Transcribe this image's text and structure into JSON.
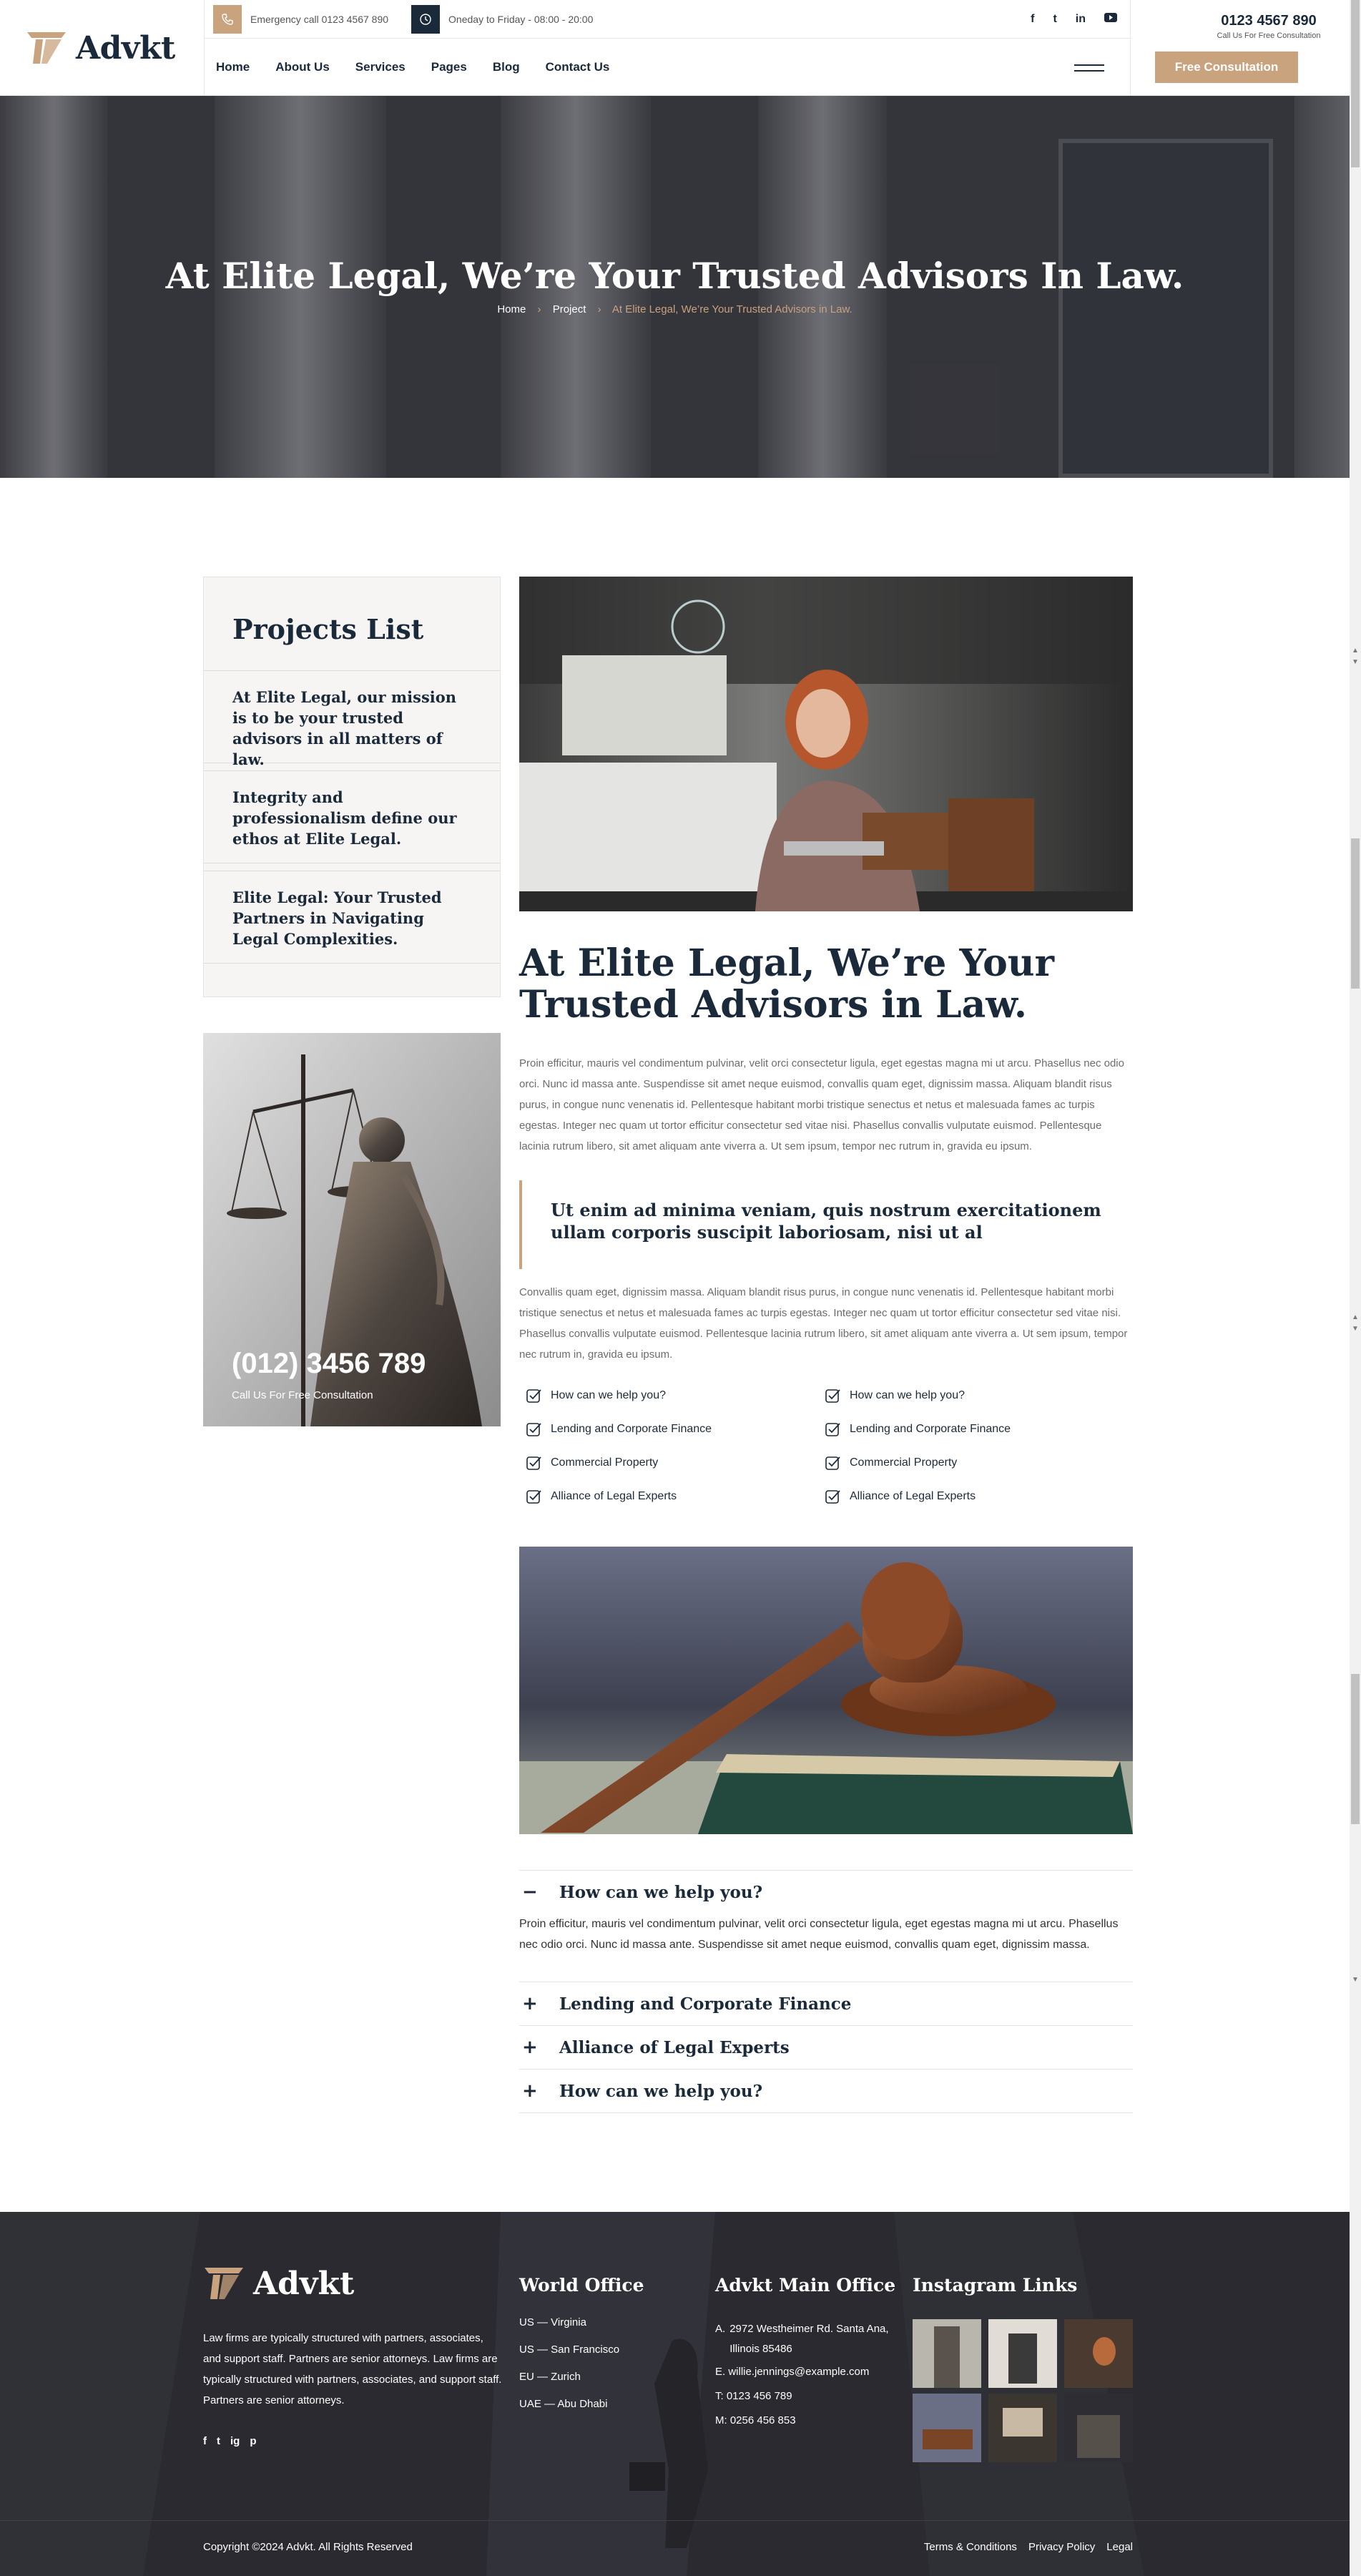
{
  "brand": {
    "name": "Advkt",
    "accent": "#c9a27e",
    "dark": "#1b2a3a"
  },
  "topbar": {
    "emergency": "Emergency call 0123 4567 890",
    "hours": "Oneday to Friday - 08:00 - 20:00",
    "social": [
      "f",
      "t",
      "in",
      "yt"
    ]
  },
  "nav": {
    "items": [
      "Home",
      "About Us",
      "Services",
      "Pages",
      "Blog",
      "Contact Us"
    ],
    "phone": "0123 4567 890",
    "phone_sub": "Call Us For Free Consultation",
    "cta": "Free Consultation"
  },
  "hero": {
    "title": "At Elite Legal, We’re Your Trusted Advisors In Law.",
    "breadcrumb": [
      "Home",
      "Project",
      "At Elite Legal, We’re Your Trusted Advisors in Law."
    ]
  },
  "sidebar": {
    "title": "Projects List",
    "items": [
      "At Elite Legal, our mission is to be your trusted advisors in all matters of law.",
      "Integrity and professionalism define our ethos at Elite Legal.",
      "Elite Legal: Your Trusted Partners in Navigating Legal Complexities."
    ],
    "phone": "(012) 3456 789",
    "phone_sub": "Call Us For Free Consultation"
  },
  "main": {
    "title": "At Elite Legal, We’re Your Trusted Advisors in Law.",
    "para1": "Proin efficitur, mauris vel condimentum pulvinar, velit orci consectetur ligula, eget egestas magna mi ut arcu. Phasellus nec odio orci. Nunc id massa ante. Suspendisse sit amet neque euismod, convallis quam eget, dignissim massa. Aliquam blandit risus purus, in congue nunc venenatis id. Pellentesque habitant morbi tristique senectus et netus et malesuada fames ac turpis egestas. Integer nec quam ut tortor efficitur consectetur sed vitae nisi. Phasellus convallis vulputate euismod. Pellentesque lacinia rutrum libero, sit amet aliquam ante viverra a. Ut sem ipsum, tempor nec rutrum in, gravida eu ipsum.",
    "quote": "Ut enim ad minima veniam, quis nostrum exercitationem ullam corporis suscipit laboriosam, nisi ut al",
    "para2": "Convallis quam eget, dignissim massa. Aliquam blandit risus purus, in congue nunc venenatis id. Pellentesque habitant morbi tristique senectus et netus et malesuada fames ac turpis egestas. Integer nec quam ut tortor efficitur consectetur sed vitae nisi. Phasellus convallis vulputate euismod. Pellentesque lacinia rutrum libero, sit amet aliquam ante viverra a. Ut sem ipsum, tempor nec rutrum in, gravida eu ipsum.",
    "checklist_left": [
      "How can we help you?",
      "Lending and Corporate Finance",
      "Commercial Property",
      "Alliance of Legal Experts"
    ],
    "checklist_right": [
      "How can we help you?",
      "Lending and Corporate Finance",
      "Commercial Property",
      "Alliance of Legal Experts"
    ]
  },
  "faq": {
    "items": [
      {
        "q": "How can we help you?",
        "a": "Proin efficitur, mauris vel condimentum pulvinar, velit orci consectetur ligula, eget egestas magna mi ut arcu. Phasellus nec odio orci. Nunc id massa ante. Suspendisse sit amet neque euismod, convallis quam eget, dignissim massa.",
        "open": true,
        "sign": "−"
      },
      {
        "q": "Lending and Corporate Finance",
        "open": false,
        "sign": "+"
      },
      {
        "q": "Alliance of Legal Experts",
        "open": false,
        "sign": "+"
      },
      {
        "q": "How can we help you?",
        "open": false,
        "sign": "+"
      }
    ]
  },
  "footer": {
    "about": "Law firms are typically structured with partners, associates, and support staff. Partners are senior attorneys. Law firms are typically structured with partners, associates, and support staff. Partners are senior attorneys.",
    "social": [
      "f",
      "t",
      "ig",
      "p"
    ],
    "world_title": "World Office",
    "world": [
      "US — Virginia",
      "US — San Francisco",
      "EU — Zurich",
      "UAE — Abu Dhabi"
    ],
    "main_office_title": "Advkt Main Office",
    "address_label": "A.",
    "address": "2972 Westheimer Rd. Santa Ana, Illinois 85486",
    "email": "E. willie.jennings@example.com",
    "tel": "T: 0123 456 789",
    "mobile": "M: 0256 456 853",
    "instagram_title": "Instagram Links",
    "copyright": "Copyright ©2024 Advkt. All Rights Reserved",
    "links": [
      "Terms & Conditions",
      "Privacy Policy",
      "Legal"
    ]
  }
}
